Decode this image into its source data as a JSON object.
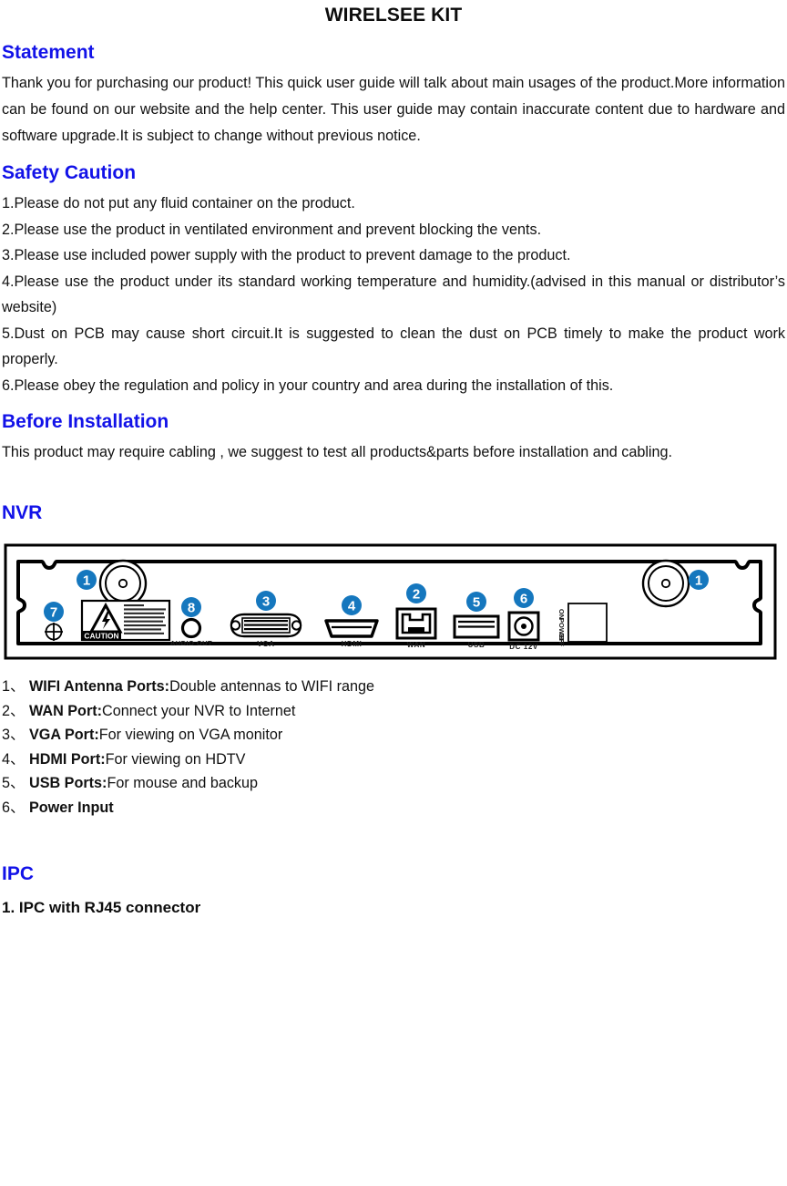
{
  "document": {
    "title": "WIRELSEE KIT"
  },
  "sections": {
    "statement": {
      "heading": "Statement",
      "body": "Thank you for purchasing our product! This quick user guide will talk about main usages of the product.More information can be found on our website and the help center. This user guide may contain inaccurate content due to hardware and software upgrade.It is subject to change without previous notice."
    },
    "safety": {
      "heading": "Safety Caution",
      "items": [
        "1.Please do not put any fluid container on the product.",
        "2.Please use the product in ventilated environment and prevent blocking the vents.",
        "3.Please use included power supply with the product to prevent damage to the product.",
        "4.Please use the product under its standard working temperature and humidity.(advised in this manual or distributor’s website)",
        "5.Dust on PCB may cause short circuit.It is suggested to clean the dust on PCB timely to make the product work properly.",
        "6.Please obey the regulation and policy in your country and area during the installation of this."
      ]
    },
    "before_installation": {
      "heading": "Before Installation",
      "body": "This product may require cabling , we suggest to test all products&parts before installation and cabling."
    },
    "nvr": {
      "heading": "NVR",
      "diagram": {
        "caution_label": "CAUTION",
        "caution_warning_text": "WARNING\nTO REDUCE THE RISK OF FIRE OR ELECTRIC SHOCK, DO NOT EXPOSE THIS APPLIANCE TO RAIN OR MOISTURE. NO USER SERVICEABLE PARTS INSIDE. REFER TO QUALIFIED SERVICE PERSONNEL.",
        "port_labels": {
          "audio_out": "AUDIO OUT",
          "vga": "VGA",
          "hdmi": "HDMI",
          "wan": "WAN",
          "usb": "USB",
          "dc": "DC 12V"
        },
        "power_switch": {
          "on": "ON",
          "power": "POWER",
          "off": "OFF"
        },
        "callouts": [
          "1",
          "2",
          "3",
          "4",
          "5",
          "6",
          "7",
          "8"
        ],
        "callout_color": "#1577be"
      },
      "legend": [
        {
          "num": "1、",
          "name": "WIFI Antenna Ports:",
          "desc": "Double antennas to WIFI range"
        },
        {
          "num": "2、",
          "name": "WAN Port:",
          "desc": "Connect your NVR to Internet"
        },
        {
          "num": "3、",
          "name": "VGA Port:",
          "desc": "For viewing on VGA monitor"
        },
        {
          "num": "4、",
          "name": "HDMI Port:",
          "desc": "For viewing on HDTV"
        },
        {
          "num": "5、",
          "name": "USB Ports:",
          "desc": "For mouse and backup"
        },
        {
          "num": "6、",
          "name": "Power Input",
          "desc": ""
        }
      ]
    },
    "ipc": {
      "heading": "IPC",
      "sub_heading": "1. IPC with RJ45 connector"
    }
  },
  "colors": {
    "heading_blue": "#1212e8",
    "callout_blue": "#1577be",
    "text_black": "#111111"
  }
}
